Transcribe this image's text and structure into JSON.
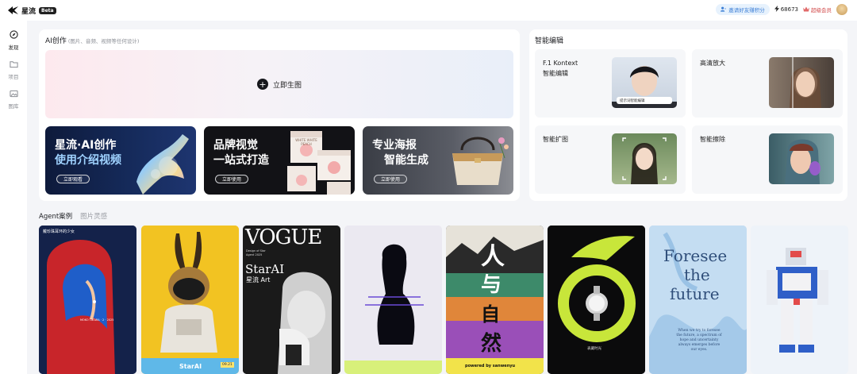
{
  "app": {
    "brand": "星流",
    "badge": "Beta"
  },
  "topbar": {
    "invite_label": "邀请好友赚积分",
    "points_value": "68673",
    "vip_label": "超级会员"
  },
  "sidebar": {
    "items": [
      {
        "label": "发现",
        "icon": "compass-icon",
        "active": true
      },
      {
        "label": "项目",
        "icon": "folder-icon",
        "active": false
      },
      {
        "label": "图库",
        "icon": "image-icon",
        "active": false
      }
    ]
  },
  "ai_create": {
    "title": "AI创作",
    "subtitle": "(图片、音频、视频等任何设计)",
    "generate_label": "立即生图"
  },
  "promos": [
    {
      "line1": "星流·AI创作",
      "line2": "使用介绍视频",
      "button": "立即观看"
    },
    {
      "line1": "品牌视觉",
      "line2": "一站式打造",
      "button": "立即使用",
      "box_text": "WHITE WHITE PEACH"
    },
    {
      "line1": "专业海报",
      "line2": "智能生成",
      "button": "立即使用"
    }
  ],
  "smart_edit": {
    "title": "智能编辑",
    "cards": [
      {
        "label_line1": "F.1 Kontext",
        "label_line2": "智能编辑",
        "thumb_caption": "提示词智能编辑"
      },
      {
        "label_line1": "高清放大",
        "label_line2": ""
      },
      {
        "label_line1": "智能扩图",
        "label_line2": ""
      },
      {
        "label_line1": "智能擦除",
        "label_line2": ""
      }
    ]
  },
  "tabs": [
    {
      "label": "Agent案例",
      "active": true
    },
    {
      "label": "图片灵感",
      "active": false
    }
  ],
  "gallery": {
    "items": [
      {
        "title": "戴珍珠耳环的少女",
        "footer": "MOKO TATARA · 2 · 2025"
      },
      {
        "footer_brand": "StarAI",
        "footer_tag": "09.21"
      },
      {
        "masthead": "VOGUE",
        "brand": "StarAI",
        "brand_cn": "星流 Art",
        "kicker": "Design of Star Agent 2025"
      },
      {},
      {
        "chars": [
          "人",
          "与",
          "自",
          "然"
        ],
        "footer": "powered by sanwenyu"
      },
      {
        "caption": "表藏时光"
      },
      {
        "headline": [
          "Foresee",
          "the",
          "future"
        ],
        "body": "When we try to foresee the future, a spectrum of hope and uncertainty always emerges before our eyes."
      },
      {}
    ]
  },
  "colors": {
    "accent": "#16171c",
    "invite_bg": "#e7f2fd",
    "invite_text": "#3d7fd6",
    "vip": "#d04545",
    "page_bg": "#f4f5f8"
  }
}
